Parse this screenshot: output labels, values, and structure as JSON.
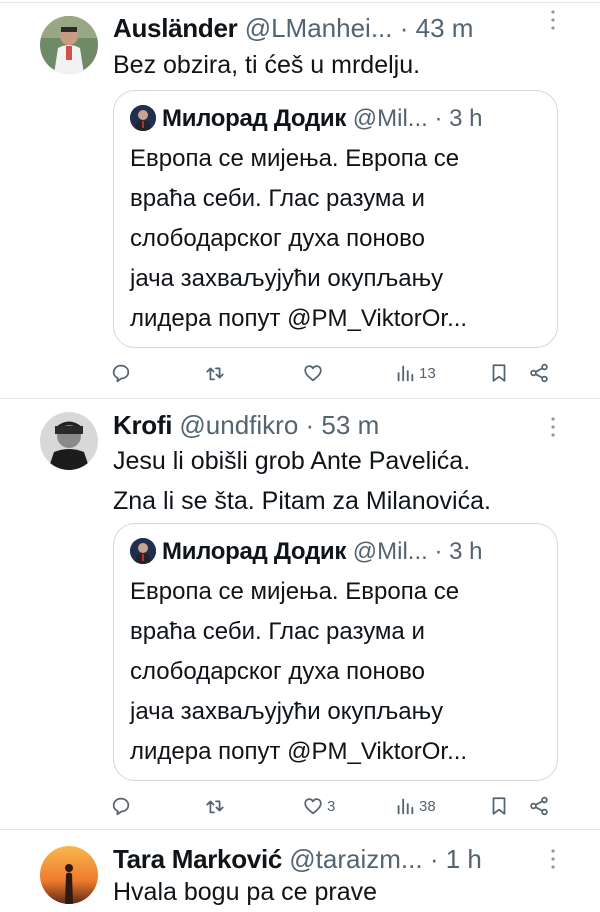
{
  "tweets": [
    {
      "name": "Ausländer",
      "handle": "@LManhei...",
      "time": "· 43 m",
      "text_lines": [
        "Bez obzira, ti ćeš u mrdelju."
      ],
      "quote": {
        "name": "Милорад Додик",
        "handle": "@Mil...",
        "time": "· 3 h",
        "lines": [
          "Европа се мијења. Европа се",
          "враћа себи. Глас разума и",
          "слободарског духа поново",
          "јача захваљујући окупљању",
          "лидера попут @PM_ViktorOr..."
        ]
      },
      "actions": {
        "reply": "",
        "retweet": "",
        "like": "",
        "views": "13"
      }
    },
    {
      "name": "Krofi",
      "handle": "@undfikro",
      "time": "· 53 m",
      "text_lines": [
        "Jesu li obišli grob Ante Pavelića.",
        "Zna li se šta. Pitam za Milanovića."
      ],
      "quote": {
        "name": "Милорад Додик",
        "handle": "@Mil...",
        "time": "· 3 h",
        "lines": [
          "Европа се мијења. Европа се",
          "враћа себи. Глас разума и",
          "слободарског духа поново",
          "јача захваљујући окупљању",
          "лидера попут @PM_ViktorOr..."
        ]
      },
      "actions": {
        "reply": "",
        "retweet": "",
        "like": "3",
        "views": "38"
      }
    },
    {
      "name": "Tara Marković",
      "handle": "@taraizm...",
      "time": "· 1 h",
      "text_lines": [
        "Hvala bogu pa ce prave"
      ]
    }
  ],
  "colors": {
    "text": "#0f1419",
    "secondary": "#536471",
    "border": "#cfd9de"
  },
  "icons": [
    "reply-icon",
    "retweet-icon",
    "like-icon",
    "views-icon",
    "bookmark-icon",
    "share-icon",
    "more-icon"
  ]
}
